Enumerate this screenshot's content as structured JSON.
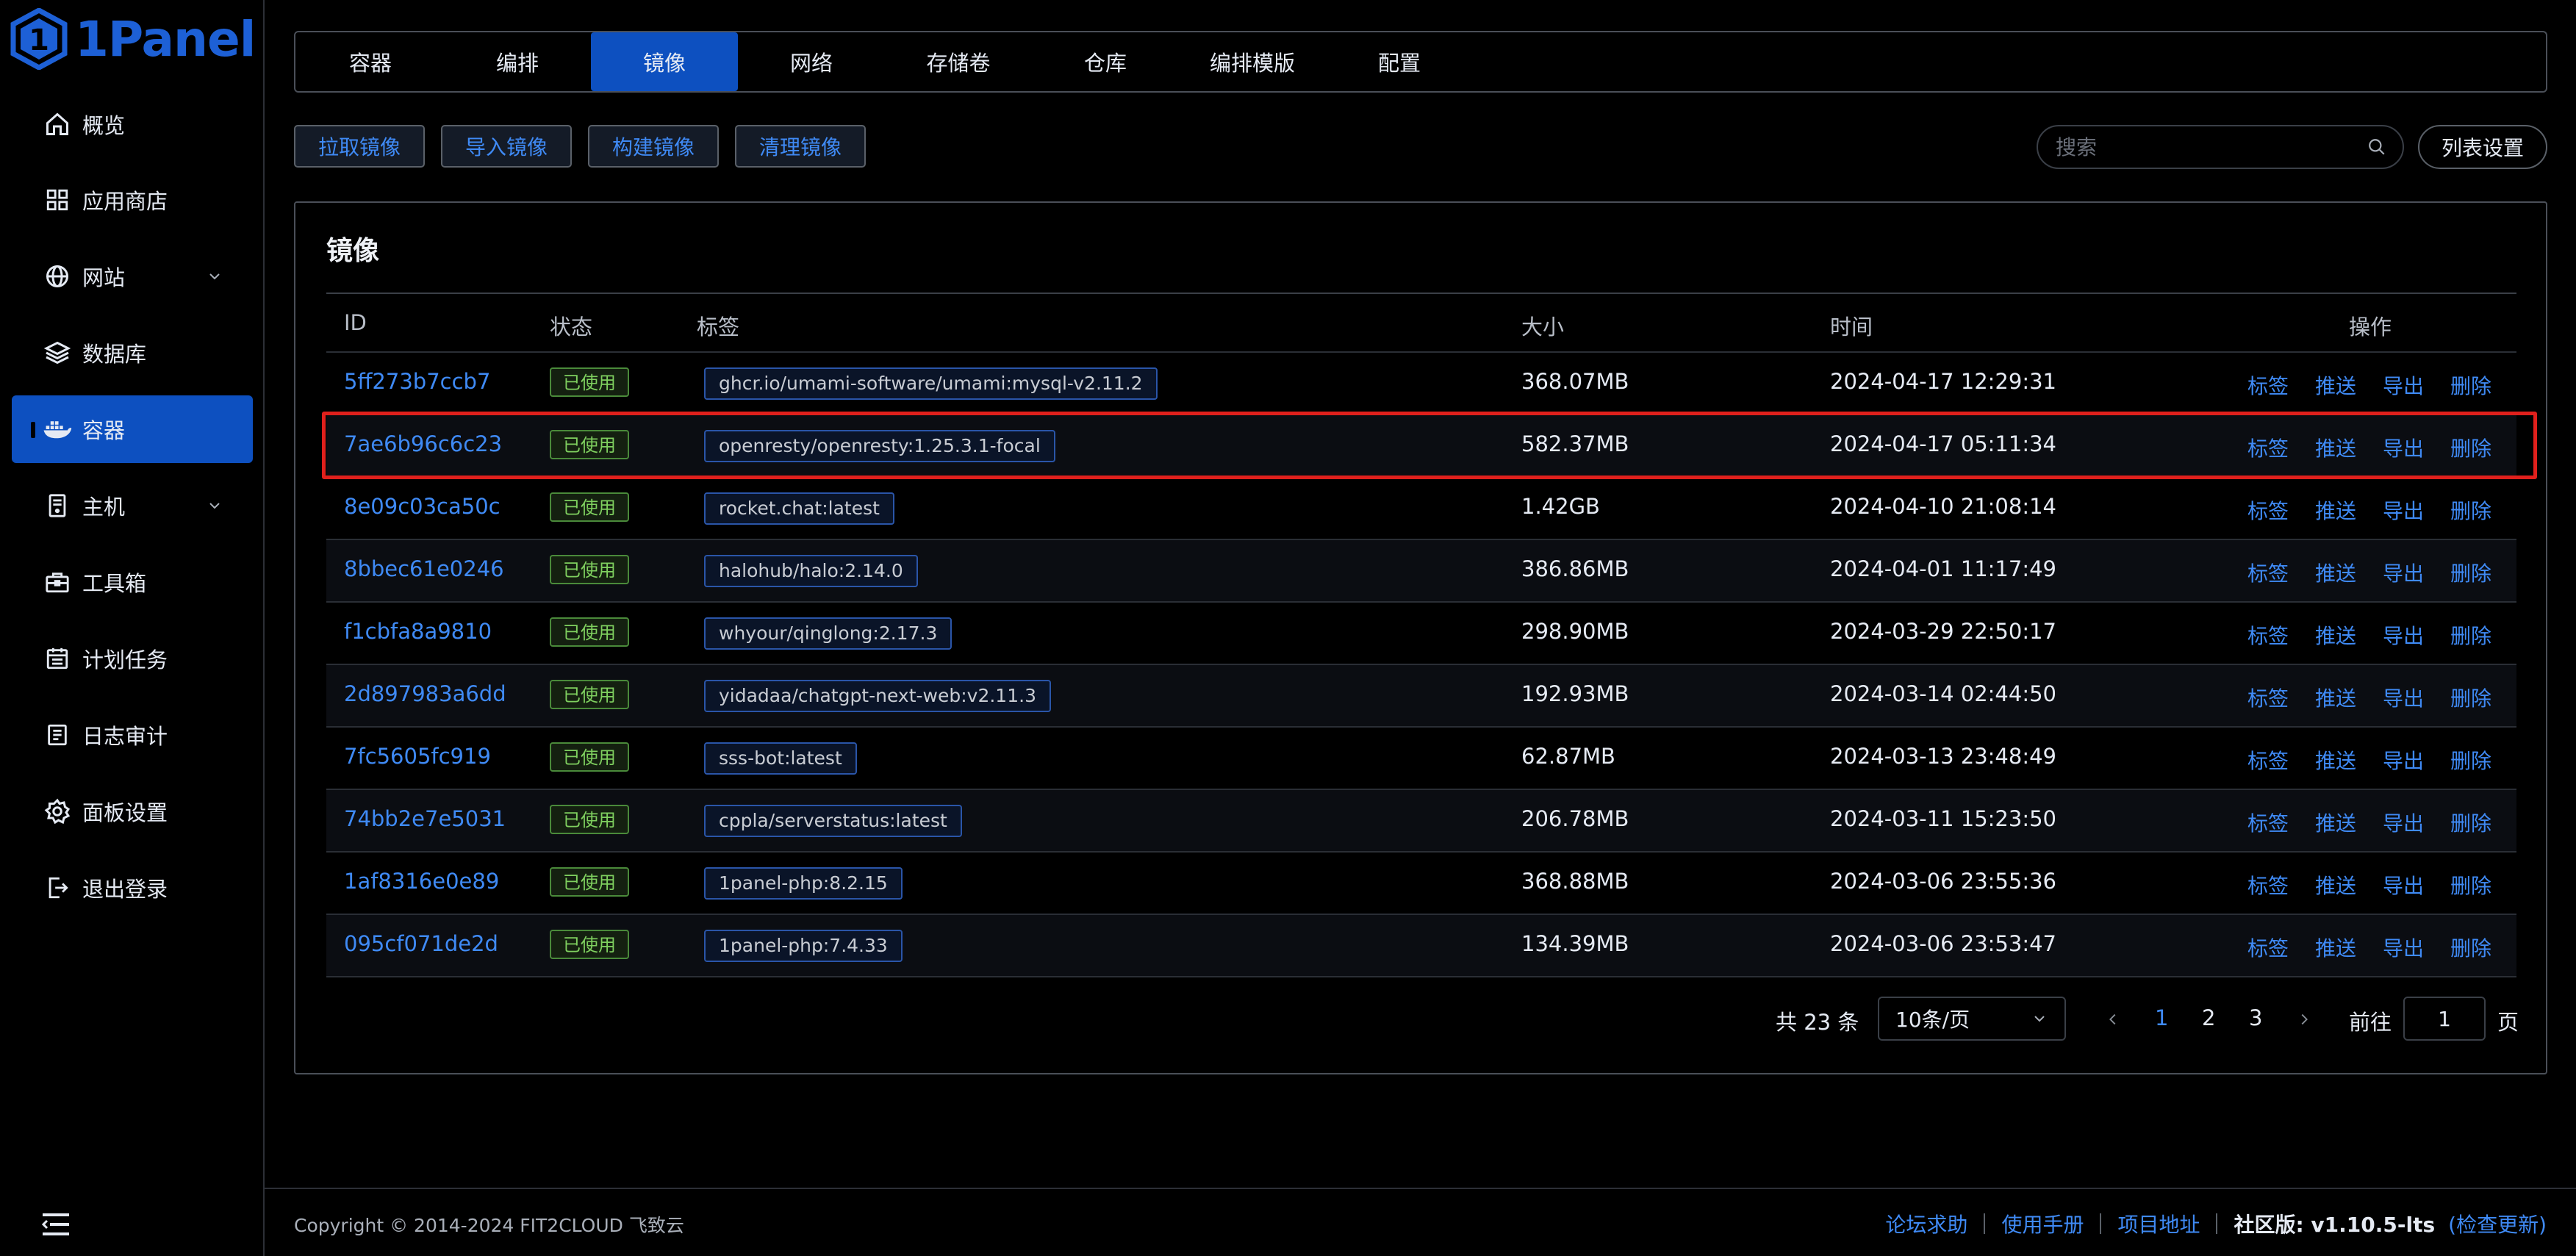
{
  "app": {
    "logo_text": "1Panel"
  },
  "sidebar": {
    "items": [
      {
        "label": "概览",
        "icon": "home-icon"
      },
      {
        "label": "应用商店",
        "icon": "grid-icon"
      },
      {
        "label": "网站",
        "icon": "globe-icon",
        "has_submenu": true
      },
      {
        "label": "数据库",
        "icon": "layers-icon"
      },
      {
        "label": "容器",
        "icon": "docker-icon",
        "active": true
      },
      {
        "label": "主机",
        "icon": "server-icon",
        "has_submenu": true
      },
      {
        "label": "工具箱",
        "icon": "toolbox-icon"
      },
      {
        "label": "计划任务",
        "icon": "calendar-icon"
      },
      {
        "label": "日志审计",
        "icon": "log-icon"
      },
      {
        "label": "面板设置",
        "icon": "gear-icon"
      },
      {
        "label": "退出登录",
        "icon": "logout-icon"
      }
    ]
  },
  "tabs": [
    "容器",
    "编排",
    "镜像",
    "网络",
    "存储卷",
    "仓库",
    "编排模版",
    "配置"
  ],
  "active_tab": "镜像",
  "toolbar": {
    "pull": "拉取镜像",
    "import": "导入镜像",
    "build": "构建镜像",
    "prune": "清理镜像",
    "search_placeholder": "搜索",
    "column_settings": "列表设置"
  },
  "card": {
    "title": "镜像"
  },
  "table": {
    "headers": {
      "id": "ID",
      "status": "状态",
      "tags": "标签",
      "size": "大小",
      "time": "时间",
      "ops": "操作"
    },
    "op_labels": [
      "标签",
      "推送",
      "导出",
      "删除"
    ],
    "rows": [
      {
        "id": "5ff273b7ccb7",
        "status": "已使用",
        "tag": "ghcr.io/umami-software/umami:mysql-v2.11.2",
        "size": "368.07MB",
        "time": "2024-04-17 12:29:31"
      },
      {
        "id": "7ae6b96c6c23",
        "status": "已使用",
        "tag": "openresty/openresty:1.25.3.1-focal",
        "size": "582.37MB",
        "time": "2024-04-17 05:11:34",
        "highlighted": true
      },
      {
        "id": "8e09c03ca50c",
        "status": "已使用",
        "tag": "rocket.chat:latest",
        "size": "1.42GB",
        "time": "2024-04-10 21:08:14"
      },
      {
        "id": "8bbec61e0246",
        "status": "已使用",
        "tag": "halohub/halo:2.14.0",
        "size": "386.86MB",
        "time": "2024-04-01 11:17:49"
      },
      {
        "id": "f1cbfa8a9810",
        "status": "已使用",
        "tag": "whyour/qinglong:2.17.3",
        "size": "298.90MB",
        "time": "2024-03-29 22:50:17"
      },
      {
        "id": "2d897983a6dd",
        "status": "已使用",
        "tag": "yidadaa/chatgpt-next-web:v2.11.3",
        "size": "192.93MB",
        "time": "2024-03-14 02:44:50"
      },
      {
        "id": "7fc5605fc919",
        "status": "已使用",
        "tag": "sss-bot:latest",
        "size": "62.87MB",
        "time": "2024-03-13 23:48:49"
      },
      {
        "id": "74bb2e7e5031",
        "status": "已使用",
        "tag": "cppla/serverstatus:latest",
        "size": "206.78MB",
        "time": "2024-03-11 15:23:50"
      },
      {
        "id": "1af8316e0e89",
        "status": "已使用",
        "tag": "1panel-php:8.2.15",
        "size": "368.88MB",
        "time": "2024-03-06 23:55:36"
      },
      {
        "id": "095cf071de2d",
        "status": "已使用",
        "tag": "1panel-php:7.4.33",
        "size": "134.39MB",
        "time": "2024-03-06 23:53:47"
      }
    ]
  },
  "pagination": {
    "total": "共 23 条",
    "page_size": "10条/页",
    "pages": [
      "1",
      "2",
      "3"
    ],
    "current": "1",
    "goto_label": "前往",
    "goto_value": "1",
    "page_suffix": "页"
  },
  "footer": {
    "copyright": "Copyright © 2014-2024 FIT2CLOUD 飞致云",
    "links": [
      "论坛求助",
      "使用手册",
      "项目地址"
    ],
    "version": "社区版: v1.10.5-lts",
    "check_update": "(检查更新)"
  },
  "colors": {
    "accent": "#0d50c0",
    "link": "#3f8af5",
    "success": "#7fd05f",
    "highlight_border": "#e0201c"
  }
}
